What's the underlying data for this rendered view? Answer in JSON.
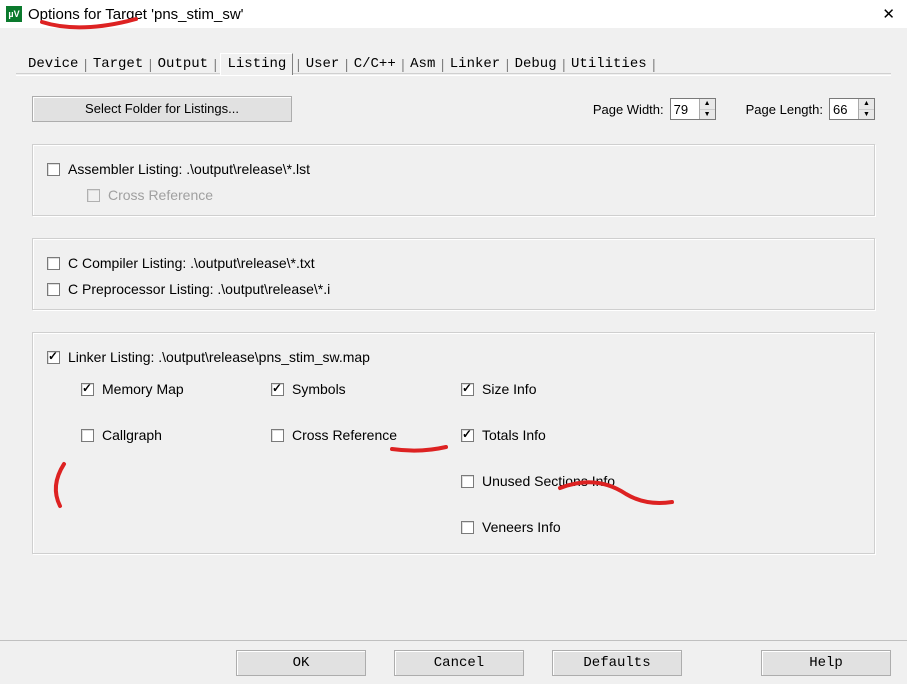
{
  "window": {
    "title": "Options for Target 'pns_stim_sw'",
    "app_icon": "µV"
  },
  "tabs": {
    "items": [
      {
        "label": "Device"
      },
      {
        "label": "Target"
      },
      {
        "label": "Output"
      },
      {
        "label": "Listing",
        "active": true
      },
      {
        "label": "User"
      },
      {
        "label": "C/C++"
      },
      {
        "label": "Asm"
      },
      {
        "label": "Linker"
      },
      {
        "label": "Debug"
      },
      {
        "label": "Utilities"
      }
    ]
  },
  "listing": {
    "select_folder_btn": "Select Folder for Listings...",
    "page_width_label": "Page Width:",
    "page_width_value": "79",
    "page_length_label": "Page Length:",
    "page_length_value": "66",
    "asm": {
      "label": "Assembler Listing:  .\\output\\release\\*.lst",
      "checked": false,
      "cross_ref_label": "Cross Reference",
      "cross_ref_checked": false,
      "cross_ref_disabled": true
    },
    "ccomp": {
      "compiler_label": "C Compiler Listing:  .\\output\\release\\*.txt",
      "compiler_checked": false,
      "prepro_label": "C Preprocessor Listing:  .\\output\\release\\*.i",
      "prepro_checked": false
    },
    "linker": {
      "label": "Linker Listing:  .\\output\\release\\pns_stim_sw.map",
      "checked": true,
      "memory_map": {
        "label": "Memory Map",
        "checked": true
      },
      "callgraph": {
        "label": "Callgraph",
        "checked": false
      },
      "symbols": {
        "label": "Symbols",
        "checked": true
      },
      "cross_reference": {
        "label": "Cross Reference",
        "checked": false
      },
      "size_info": {
        "label": "Size Info",
        "checked": true
      },
      "totals_info": {
        "label": "Totals Info",
        "checked": true
      },
      "unused_sections": {
        "label": "Unused Sections Info",
        "checked": false
      },
      "veneers": {
        "label": "Veneers Info",
        "checked": false
      }
    }
  },
  "buttons": {
    "ok": "OK",
    "cancel": "Cancel",
    "defaults": "Defaults",
    "help": "Help"
  }
}
